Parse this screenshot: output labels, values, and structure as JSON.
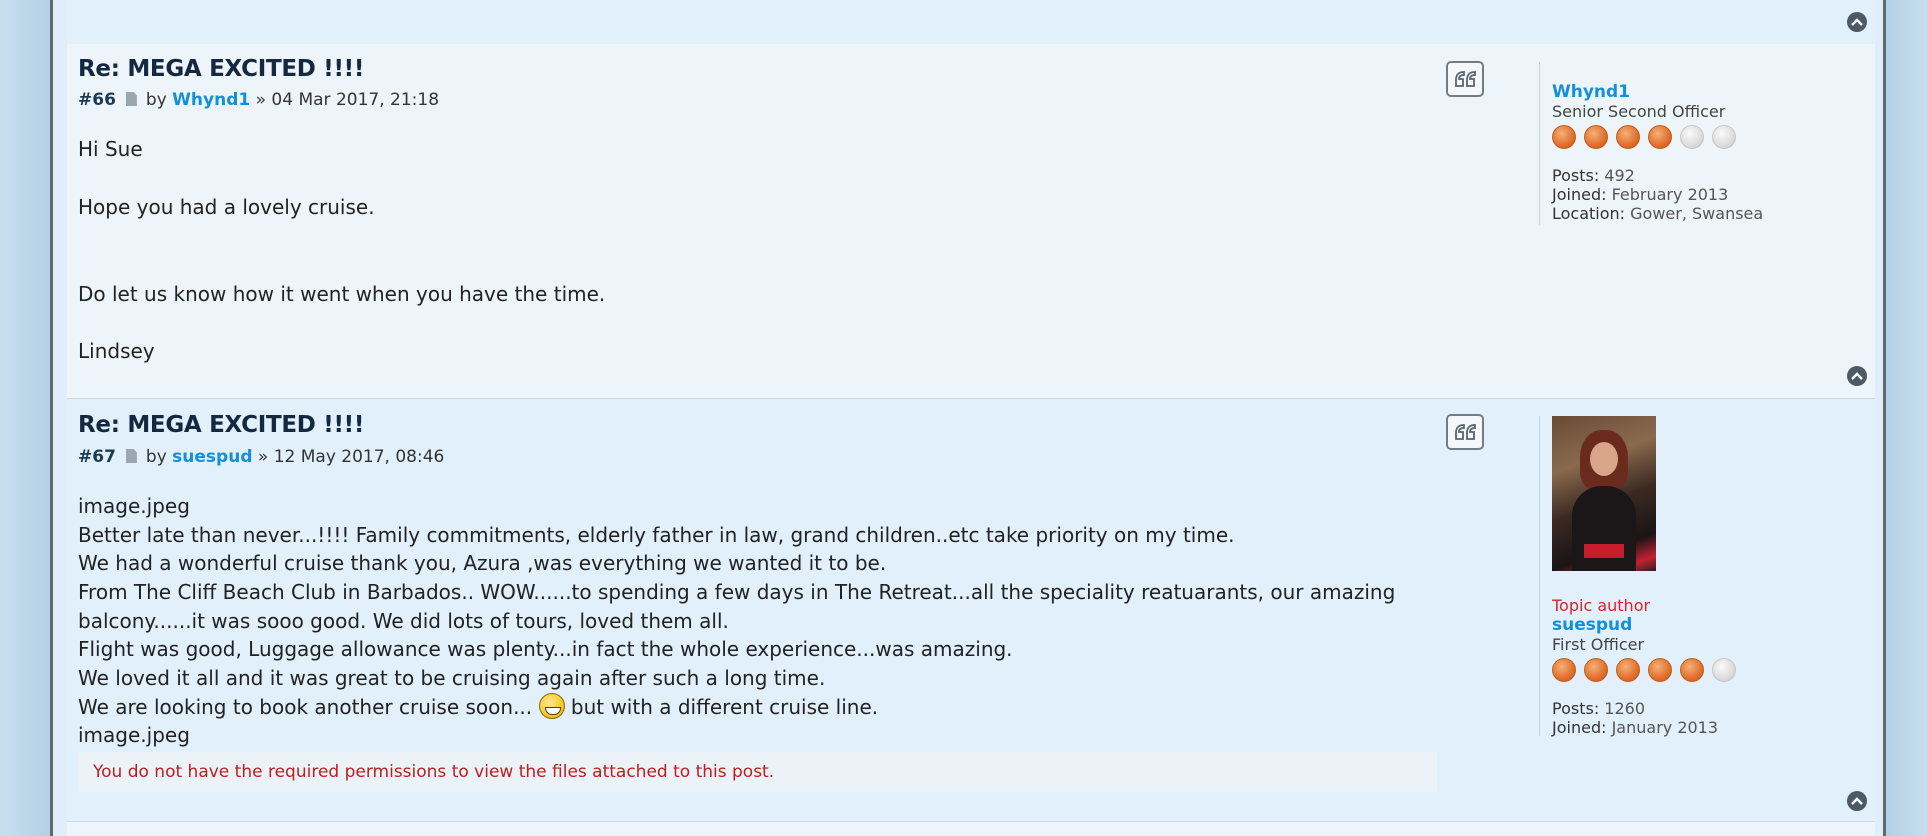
{
  "posts": [
    {
      "title": "Re: MEGA EXCITED !!!!",
      "number": "#66",
      "by": "by",
      "author": "Whynd1",
      "date": "» 04 Mar 2017, 21:18",
      "lines": [
        "Hi Sue",
        "Hope you had a lovely cruise.",
        "Do let us know how it went when you have the time.",
        "Lindsey"
      ],
      "profile": {
        "username": "Whynd1",
        "rank": "Senior Second Officer",
        "pips_on": 4,
        "pips_total": 6,
        "posts_label": "Posts:",
        "posts": "492",
        "joined_label": "Joined:",
        "joined": "February 2013",
        "location_label": "Location:",
        "location": "Gower, Swansea"
      }
    },
    {
      "title": "Re: MEGA EXCITED !!!!",
      "number": "#67",
      "by": "by",
      "author": "suespud",
      "date": "» 12 May 2017, 08:46",
      "lines": [
        "image.jpeg",
        "Better late than never...!!!! Family commitments, elderly father in law, grand children..etc take priority on my time.",
        "We had a wonderful cruise thank you, Azura ,was everything we wanted it to be.",
        "From The Cliff Beach Club in Barbados.. WOW......to spending a few days in The Retreat...all the speciality reatuarants, our amazing",
        "balcony......it was sooo good. We did lots of tours, loved them all.",
        "Flight was good, Luggage allowance was plenty...in fact the whole experience...was amazing.",
        "We loved it all and it was great to be cruising again after such a long time.",
        "We are looking to book another cruise soon...",
        "but with a different cruise line.",
        "image.jpeg"
      ],
      "notice": "You do not have the required permissions to view the files attached to this post.",
      "profile": {
        "topic_author": "Topic author",
        "username": "suespud",
        "rank": "First Officer",
        "pips_on": 5,
        "pips_total": 6,
        "posts_label": "Posts:",
        "posts": "1260",
        "joined_label": "Joined:",
        "joined": "January 2013"
      }
    }
  ],
  "icons": {
    "quote": "quote-icon",
    "top": "chevron-up-icon",
    "doc": "document-icon",
    "smiley": "grinning-smiley-icon"
  }
}
